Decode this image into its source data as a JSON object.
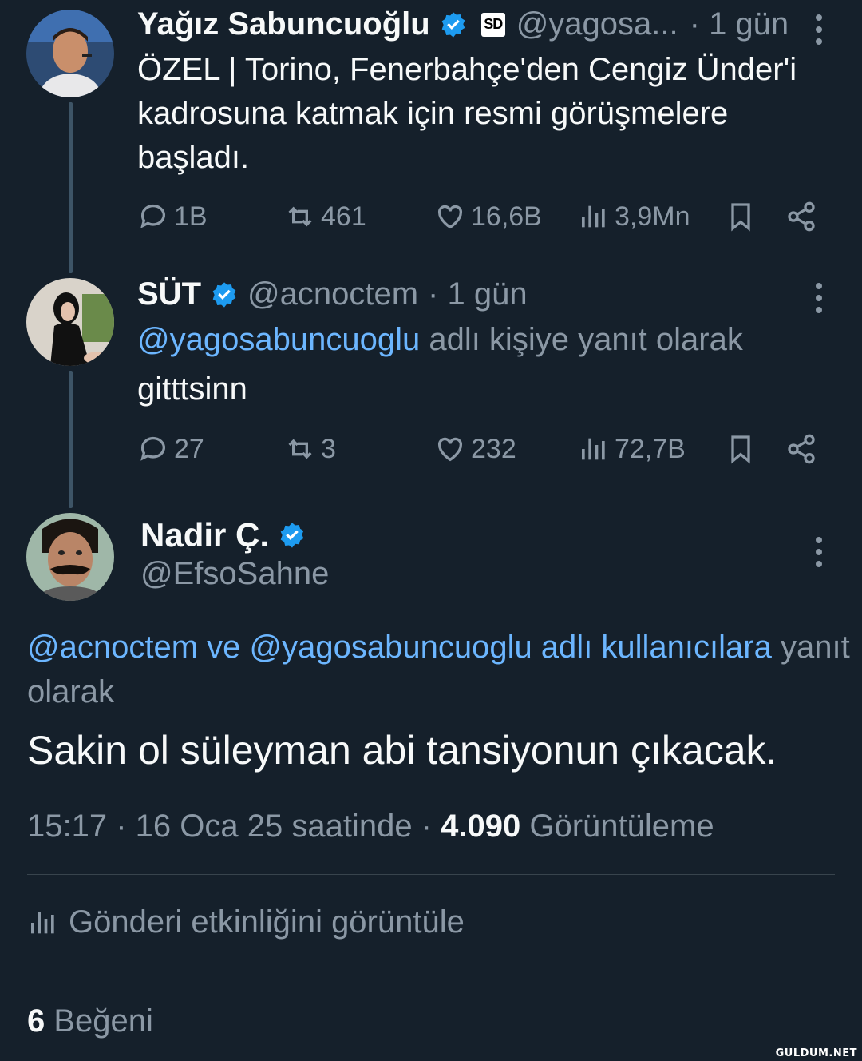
{
  "tweets": [
    {
      "name": "Yağız Sabuncuoğlu",
      "badge": "SD",
      "handle": "@yagosa...",
      "time": "· 1 gün",
      "text": "ÖZEL | Torino, Fenerbahçe'den Cengiz Ünder'i kadrosuna katmak için resmi görüşmelere başladı.",
      "replies": "1B",
      "retweets": "461",
      "likes": "16,6B",
      "views": "3,9Mn"
    },
    {
      "name": "SÜT",
      "handle": "@acnoctem",
      "time": "· 1 gün",
      "reply_mention": "@yagosabuncuoglu",
      "reply_suffix": "adlı kişiye yanıt olarak",
      "text": "gitttsinn",
      "replies": "27",
      "retweets": "3",
      "likes": "232",
      "views": "72,7B"
    }
  ],
  "main_tweet": {
    "name": "Nadir Ç.",
    "handle": "@EfsoSahne",
    "reply_links": "@acnoctem ve @yagosabuncuoglu adlı kullanıcılara",
    "reply_word": "yanıt",
    "reply_tail": "olarak",
    "text": "Sakin ol süleyman abi tansiyonun çıkacak.",
    "time_date": "15:17 · 16 Oca 25 saatinde · ",
    "views_count": "4.090",
    "views_label": " Görüntüleme",
    "activity_label": "Gönderi etkinliğini görüntüle",
    "likes_count": "6",
    "likes_label": " Beğeni"
  },
  "watermark": "GULDUM.NET",
  "colors": {
    "background": "#15202b",
    "link": "#6cb6ff",
    "muted": "#8b98a5",
    "verified": "#1d9bf0"
  },
  "icons": [
    "reply-icon",
    "retweet-icon",
    "like-icon",
    "views-icon",
    "bookmark-icon",
    "share-icon",
    "verified-icon",
    "more-icon"
  ]
}
